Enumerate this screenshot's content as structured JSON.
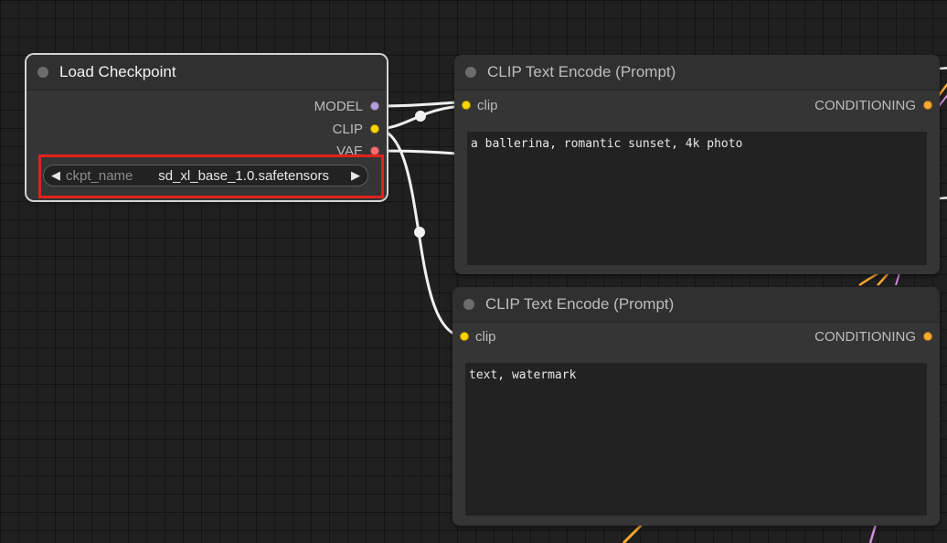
{
  "canvas": {
    "background": "#202020"
  },
  "colors": {
    "model": "#b39ddb",
    "clip": "#ffd500",
    "vae": "#ff6e6e",
    "conditioning": "#ffa931",
    "wire": "#f0f0f0",
    "highlight": "#e0231c"
  },
  "load_checkpoint": {
    "title": "Load Checkpoint",
    "outputs": {
      "model": "MODEL",
      "clip": "CLIP",
      "vae": "VAE"
    },
    "widget": {
      "name": "ckpt_name",
      "value": "sd_xl_base_1.0.safetensors",
      "prev_icon": "◀",
      "next_icon": "▶"
    }
  },
  "positive_prompt": {
    "title": "CLIP Text Encode (Prompt)",
    "input": "clip",
    "output": "CONDITIONING",
    "text": "a ballerina, romantic sunset, 4k photo"
  },
  "negative_prompt": {
    "title": "CLIP Text Encode (Prompt)",
    "input": "clip",
    "output": "CONDITIONING",
    "text": "text, watermark"
  }
}
